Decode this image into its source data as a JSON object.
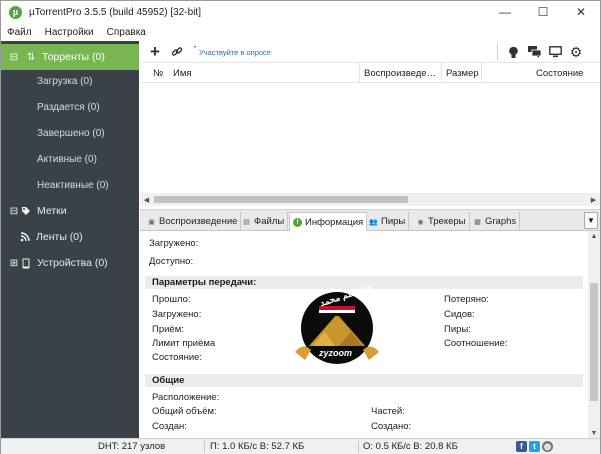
{
  "window": {
    "title": "µTorrentPro 3.5.5 (build 45952) [32-bit]",
    "controls": [
      "—",
      "☐",
      "✕"
    ]
  },
  "menu": [
    "Файл",
    "Настройки",
    "Справка"
  ],
  "sidebar": {
    "torrents": "Торренты (0)",
    "sub": [
      "Загрузка (0)",
      "Раздается (0)",
      "Завершено (0)",
      "Активные (0)",
      "Неактивные (0)"
    ],
    "labels": "Метки",
    "feeds": "Ленты (0)",
    "devices": "Устройства (0)"
  },
  "toolbar": {
    "add_icon": "plus-icon",
    "link_icon": "link-icon",
    "survey_link": "Участвуйте в опросе",
    "right_icons": [
      "bulb-icon",
      "chat-icon",
      "monitor-icon",
      "gear-icon"
    ]
  },
  "list": {
    "columns": [
      "№",
      "Имя",
      "Воспроизведе…",
      "Размер",
      "Состояние"
    ]
  },
  "tabs": [
    {
      "label": "Воспроизведение",
      "icon": "play-icon"
    },
    {
      "label": "Файлы",
      "icon": "files-icon"
    },
    {
      "label": "Информация",
      "icon": "info-icon"
    },
    {
      "label": "Пиры",
      "icon": "peers-icon"
    },
    {
      "label": "Трекеры",
      "icon": "tracker-icon"
    },
    {
      "label": "Graphs",
      "icon": "graph-icon"
    }
  ],
  "info": {
    "downloaded": "Загружено:",
    "available": "Доступно:",
    "transfer_header": "Параметры передачи:",
    "col1": [
      "Прошло:",
      "Загружено:",
      "Приём:",
      "Лимит приёма",
      "Состояние:"
    ],
    "col2": [
      "Потеряно:",
      "Сидов:",
      "Пиры:",
      "Соотношение:"
    ],
    "general_header": "Общие",
    "g_col1": [
      "Расположение:",
      "Общий объём:",
      "Создан:"
    ],
    "g_col2": [
      "Частей:",
      "Создано:"
    ]
  },
  "watermark": {
    "text": "zyzoom",
    "arabic": "هانو علم محمد"
  },
  "status": {
    "dht": "DHT: 217 узлов",
    "download": "П: 1.0 КБ/с В: 52.7 КБ",
    "upload": "О: 0.5 КБ/с В: 20.8 КБ"
  },
  "colors": {
    "sidebar_bg": "#3b4148",
    "sidebar_active": "#79b651",
    "link": "#2a6ebb"
  }
}
